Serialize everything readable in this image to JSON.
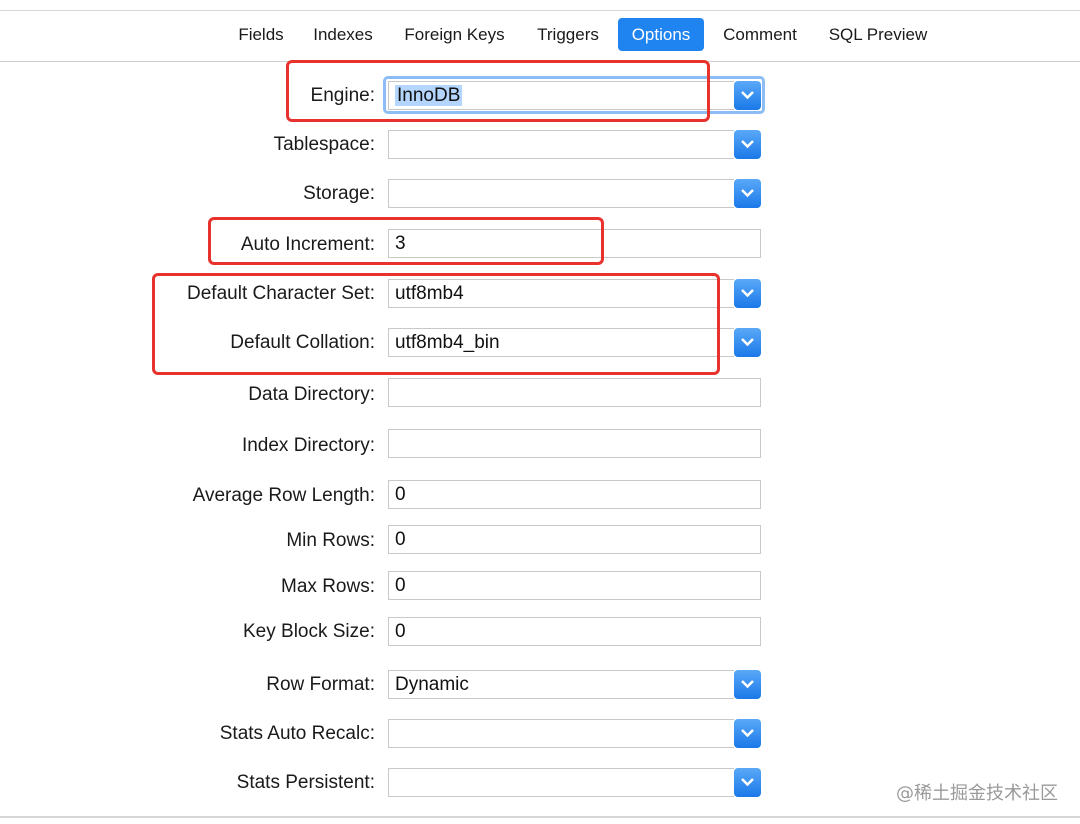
{
  "tabs": [
    "Fields",
    "Indexes",
    "Foreign Keys",
    "Triggers",
    "Options",
    "Comment",
    "SQL Preview"
  ],
  "active_tab": "Options",
  "options": {
    "engine": {
      "label": "Engine:",
      "value": "InnoDB"
    },
    "tablespace": {
      "label": "Tablespace:",
      "value": ""
    },
    "storage": {
      "label": "Storage:",
      "value": ""
    },
    "auto_increment": {
      "label": "Auto Increment:",
      "value": "3"
    },
    "default_charset": {
      "label": "Default Character Set:",
      "value": "utf8mb4"
    },
    "default_collation": {
      "label": "Default Collation:",
      "value": "utf8mb4_bin"
    },
    "data_directory": {
      "label": "Data Directory:",
      "value": ""
    },
    "index_directory": {
      "label": "Index Directory:",
      "value": ""
    },
    "avg_row_length": {
      "label": "Average Row Length:",
      "value": "0"
    },
    "min_rows": {
      "label": "Min Rows:",
      "value": "0"
    },
    "max_rows": {
      "label": "Max Rows:",
      "value": "0"
    },
    "key_block_size": {
      "label": "Key Block Size:",
      "value": "0"
    },
    "row_format": {
      "label": "Row Format:",
      "value": "Dynamic"
    },
    "stats_auto_recalc": {
      "label": "Stats Auto Recalc:",
      "value": ""
    },
    "stats_persistent": {
      "label": "Stats Persistent:",
      "value": ""
    }
  },
  "watermark": "@稀土掘金技术社区",
  "colors": {
    "accent": "#1f84f0",
    "annotation_red": "#e8322e",
    "selection_highlight": "#b4d5fe"
  }
}
